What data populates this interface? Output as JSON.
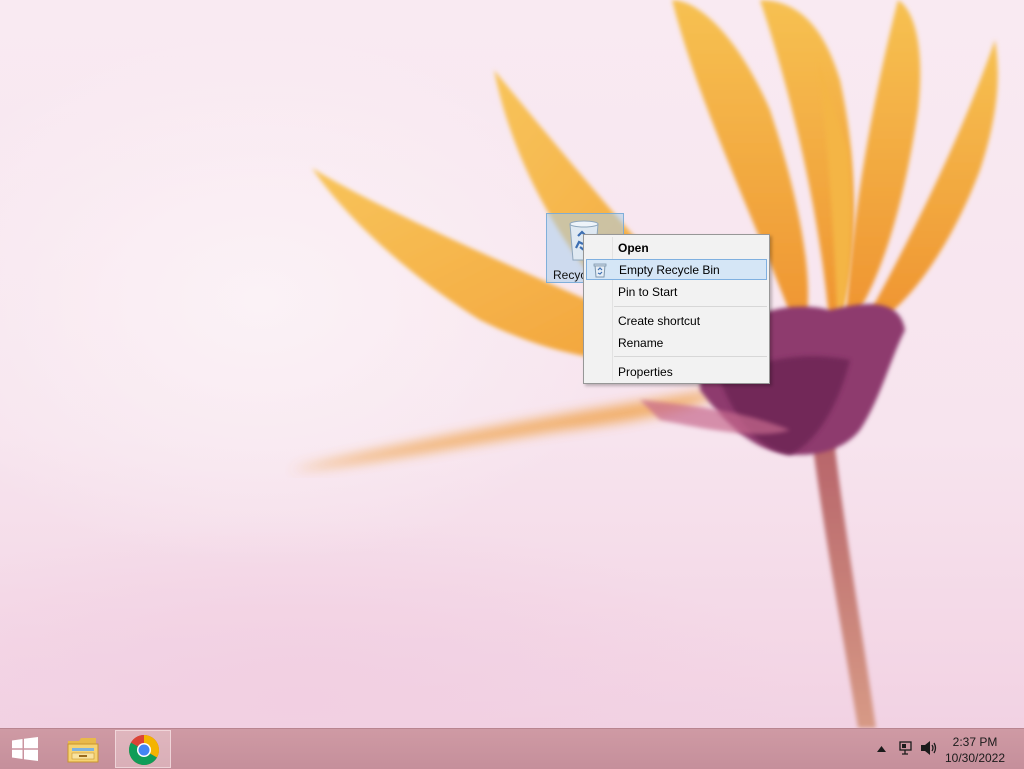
{
  "desktop": {
    "icon_label": "Recycle Bin"
  },
  "context_menu": {
    "items": [
      {
        "label": "Open",
        "default": true
      },
      {
        "label": "Empty Recycle Bin",
        "highlighted": true,
        "icon": "recycle-bin-icon"
      },
      {
        "label": "Pin to Start"
      },
      {
        "label": "Create shortcut"
      },
      {
        "label": "Rename"
      },
      {
        "label": "Properties"
      }
    ]
  },
  "taskbar": {
    "start_icon": "windows-logo-icon",
    "pinned": [
      {
        "name": "File Explorer",
        "icon": "file-explorer-icon"
      },
      {
        "name": "Google Chrome",
        "icon": "chrome-icon",
        "active": true
      }
    ],
    "tray": {
      "time": "2:37 PM",
      "date": "10/30/2022"
    }
  },
  "colors": {
    "taskbar": "#c8929d",
    "menu_highlight": "#d5e6f6",
    "petal": "#f7b13c"
  }
}
